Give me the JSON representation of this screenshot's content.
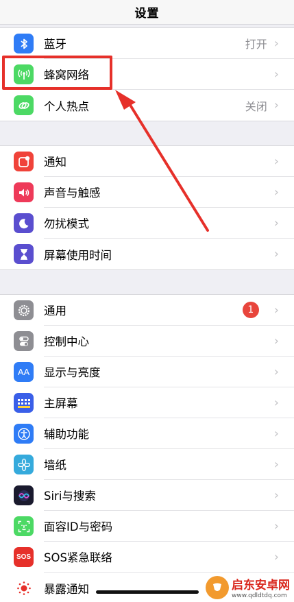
{
  "nav": {
    "title": "设置"
  },
  "group1": [
    {
      "label": "蓝牙",
      "value": "打开",
      "icon": "bluetooth-icon",
      "color": "#2f7cf6"
    },
    {
      "label": "蜂窝网络",
      "value": "",
      "icon": "antenna-icon",
      "color": "#4cd964"
    },
    {
      "label": "个人热点",
      "value": "关闭",
      "icon": "hotspot-link-icon",
      "color": "#4cd964"
    }
  ],
  "group2": [
    {
      "label": "通知",
      "icon": "notification-icon",
      "color": "#f0433a"
    },
    {
      "label": "声音与触感",
      "icon": "speaker-icon",
      "color": "#ee3a59"
    },
    {
      "label": "勿扰模式",
      "icon": "moon-icon",
      "color": "#5a4ecf"
    },
    {
      "label": "屏幕使用时间",
      "icon": "hourglass-icon",
      "color": "#5a4ecf"
    }
  ],
  "group3": [
    {
      "label": "通用",
      "badge": "1",
      "icon": "gear-icon",
      "color": "#8e8e93"
    },
    {
      "label": "控制中心",
      "icon": "toggles-icon",
      "color": "#8e8e93"
    },
    {
      "label": "显示与亮度",
      "icon": "text-size-icon",
      "color": "#2f7cf6",
      "glyph": "AA"
    },
    {
      "label": "主屏幕",
      "icon": "home-grid-icon",
      "color": "#3a5fe8"
    },
    {
      "label": "辅助功能",
      "icon": "accessibility-icon",
      "color": "#2f7cf6"
    },
    {
      "label": "墙纸",
      "icon": "flower-icon",
      "color": "#35aadc"
    },
    {
      "label": "Siri与搜索",
      "icon": "siri-icon",
      "color": "#1a1a2e"
    },
    {
      "label": "面容ID与密码",
      "icon": "face-id-icon",
      "color": "#4cd964"
    },
    {
      "label": "SOS紧急联络",
      "icon": "sos-icon",
      "color": "#e6302a",
      "glyph": "SOS"
    },
    {
      "label": "暴露通知",
      "icon": "exposure-icon",
      "color": "#ffffff"
    }
  ],
  "chevron": "›",
  "watermark": {
    "title": "启东安卓网",
    "url": "www.qdldtdq.com"
  }
}
